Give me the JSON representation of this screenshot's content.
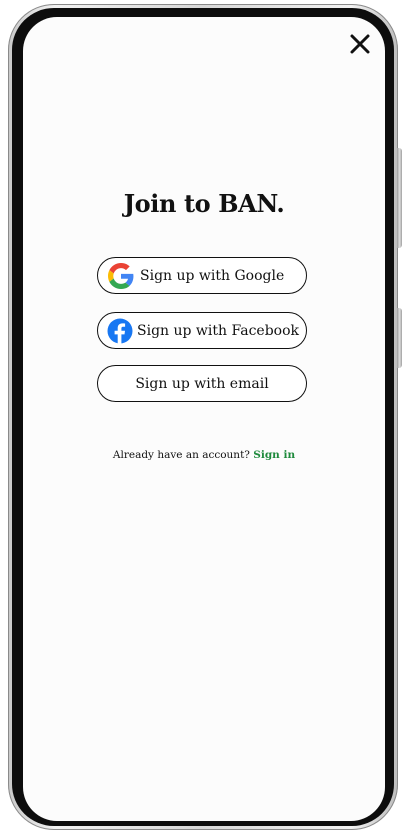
{
  "screen": {
    "title": "Join to BAN.",
    "close_icon": "close-icon"
  },
  "buttons": {
    "google_label": "Sign up with Google",
    "facebook_label": "Sign up with Facebook",
    "email_label": "Sign up with email"
  },
  "signin": {
    "prompt": "Already have an account?",
    "link": "Sign in",
    "link_color": "#1e8a3c"
  },
  "icons": {
    "google": "google-logo-icon",
    "facebook": "facebook-logo-icon"
  }
}
